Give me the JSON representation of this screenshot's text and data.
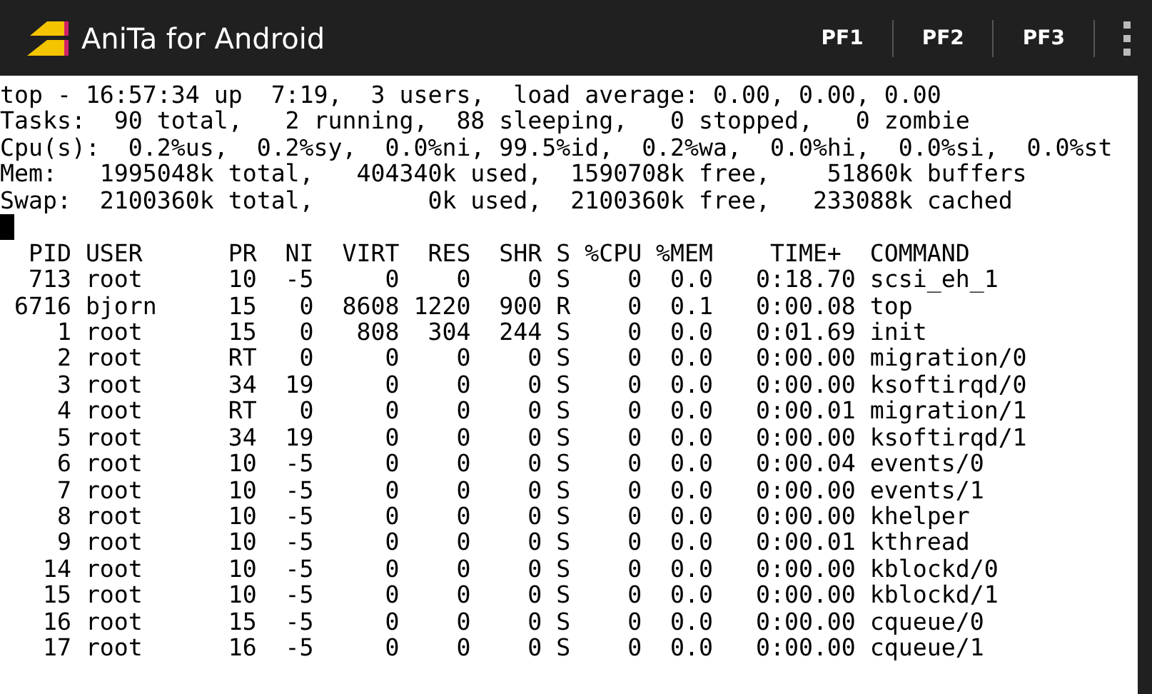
{
  "app_bar": {
    "title": "AniTa for Android",
    "buttons": [
      "PF1",
      "PF2",
      "PF3"
    ]
  },
  "terminal": {
    "summary": [
      "top - 16:57:34 up  7:19,  3 users,  load average: 0.00, 0.00, 0.00",
      "Tasks:  90 total,   2 running,  88 sleeping,   0 stopped,   0 zombie",
      "Cpu(s):  0.2%us,  0.2%sy,  0.0%ni, 99.5%id,  0.2%wa,  0.0%hi,  0.0%si,  0.0%st",
      "Mem:   1995048k total,   404340k used,  1590708k free,    51860k buffers",
      "Swap:  2100360k total,        0k used,  2100360k free,   233088k cached"
    ],
    "cursor": true,
    "process_lines": [
      "  PID USER      PR  NI  VIRT  RES  SHR S %CPU %MEM    TIME+  COMMAND",
      "  713 root      10  -5     0    0    0 S    0  0.0   0:18.70 scsi_eh_1",
      " 6716 bjorn     15   0  8608 1220  900 R    0  0.1   0:00.08 top",
      "    1 root      15   0   808  304  244 S    0  0.0   0:01.69 init",
      "    2 root      RT   0     0    0    0 S    0  0.0   0:00.00 migration/0",
      "    3 root      34  19     0    0    0 S    0  0.0   0:00.00 ksoftirqd/0",
      "    4 root      RT   0     0    0    0 S    0  0.0   0:00.01 migration/1",
      "    5 root      34  19     0    0    0 S    0  0.0   0:00.00 ksoftirqd/1",
      "    6 root      10  -5     0    0    0 S    0  0.0   0:00.04 events/0",
      "    7 root      10  -5     0    0    0 S    0  0.0   0:00.00 events/1",
      "    8 root      10  -5     0    0    0 S    0  0.0   0:00.00 khelper",
      "    9 root      10  -5     0    0    0 S    0  0.0   0:00.01 kthread",
      "   14 root      10  -5     0    0    0 S    0  0.0   0:00.00 kblockd/0",
      "   15 root      10  -5     0    0    0 S    0  0.0   0:00.00 kblockd/1",
      "   16 root      15  -5     0    0    0 S    0  0.0   0:00.00 cqueue/0",
      "   17 root      16  -5     0    0    0 S    0  0.0   0:00.00 cqueue/1"
    ]
  }
}
